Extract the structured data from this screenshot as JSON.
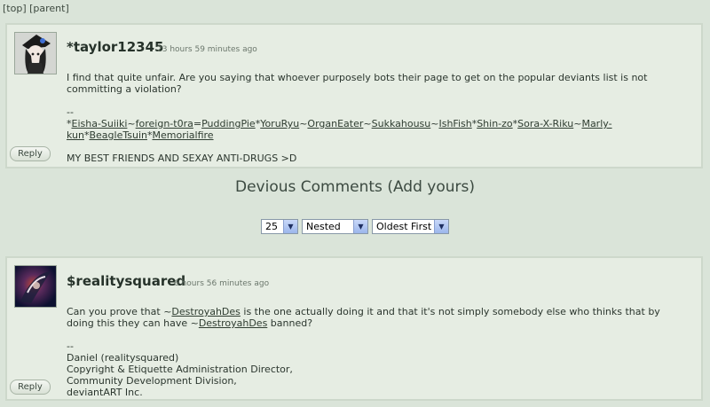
{
  "nav": {
    "top": "[top]",
    "parent": "[parent]"
  },
  "comments": [
    {
      "author": "*taylor12345",
      "timestamp": "23 hours 59 minutes ago",
      "text": "I find that quite unfair. Are you saying that whoever purposely bots their page to get on the popular deviants list is not committing a violation?",
      "sig_sep": "--",
      "sig_links": [
        "Eisha-Suiiki",
        "foreign-t0ra",
        "PuddingPie",
        "YoruRyu",
        "OrganEater",
        "Sukkahousu",
        "IshFish",
        "Shin-zo",
        "Sora-X-Riku",
        "Marly-kun",
        "BeagleTsuin",
        "Memorialfire"
      ],
      "sig_separators": [
        "*",
        "~",
        "=",
        "*",
        "~",
        "~",
        "~",
        "*",
        "*",
        "~",
        "*",
        "*"
      ],
      "sig_tag": "MY BEST FRIENDS AND SEXAY ANTI-DRUGS >D",
      "reply": "Reply"
    },
    {
      "author": "$realitysquared",
      "timestamp": "6 hours 56 minutes ago",
      "text_a": "Can you prove that ~",
      "link_a": "DestroyahDes",
      "text_b": " is the one actually doing it and that it's not simply somebody else who thinks that by doing this they can have ~",
      "link_b": "DestroyahDes",
      "text_c": " banned?",
      "sig_sep": "--",
      "sig_lines": [
        "Daniel (realitysquared)",
        "Copyright & Etiquette Administration Director,",
        "Community Development Division,",
        "deviantART Inc."
      ],
      "reply": "Reply"
    }
  ],
  "section": {
    "title": "Devious Comments",
    "open": "(",
    "add": "Add yours",
    "close": ")"
  },
  "controls": {
    "count": "25",
    "mode": "Nested",
    "order": "Oldest First"
  },
  "colors": {
    "background": "#dae4d9",
    "panel": "#e6ede3",
    "text": "#2d3a31"
  }
}
